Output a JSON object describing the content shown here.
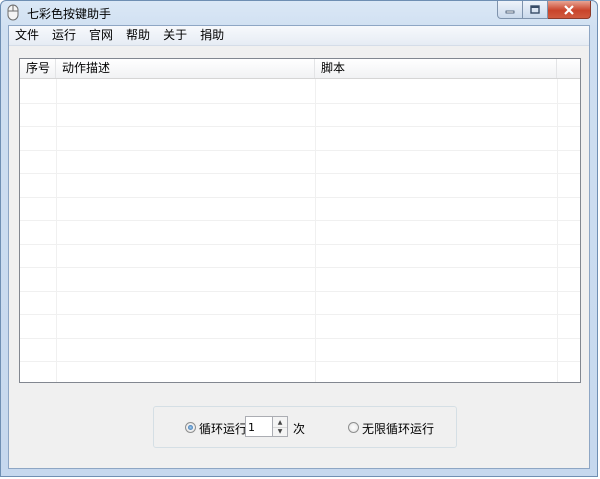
{
  "window": {
    "title": "七彩色按键助手"
  },
  "menu": {
    "items": [
      {
        "label": "文件"
      },
      {
        "label": "运行"
      },
      {
        "label": "官网"
      },
      {
        "label": "帮助"
      },
      {
        "label": "关于"
      },
      {
        "label": "捐助"
      }
    ]
  },
  "table": {
    "columns": [
      {
        "label": "序号"
      },
      {
        "label": "动作描述"
      },
      {
        "label": "脚本"
      }
    ],
    "rows": []
  },
  "loop": {
    "loop_run_label": "循环运行",
    "count_value": "1",
    "times_unit": "次",
    "infinite_label": "无限循环运行",
    "selected": "loop_run"
  },
  "colors": {
    "window_frame": "#c6d8ee",
    "client_bg": "#f0f0f0",
    "close_button": "#c9442b"
  }
}
